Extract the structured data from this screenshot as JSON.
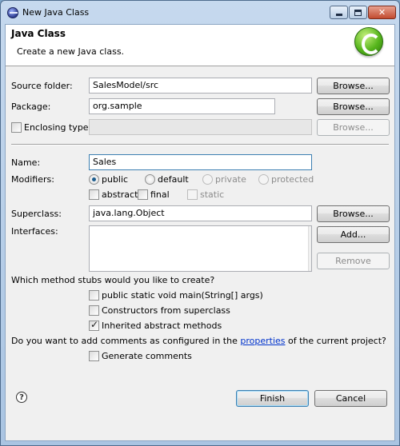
{
  "window": {
    "title": "New Java Class",
    "close_glyph": "✕",
    "buttons": [
      "minimize",
      "maximize",
      "close"
    ]
  },
  "banner": {
    "title": "Java Class",
    "description": "Create a new Java class.",
    "logo": "java-class-logo-icon"
  },
  "source_folder": {
    "label": "Source folder:",
    "value": "SalesModel/src",
    "browse": "Browse..."
  },
  "package": {
    "label": "Package:",
    "value": "org.sample",
    "browse": "Browse..."
  },
  "enclosing_type": {
    "label": "Enclosing type:",
    "value": "",
    "checked": false,
    "browse": "Browse..."
  },
  "name": {
    "label": "Name:",
    "value": "Sales"
  },
  "modifiers": {
    "label": "Modifiers:",
    "visibility": [
      {
        "label": "public",
        "selected": true,
        "enabled": true
      },
      {
        "label": "default",
        "selected": false,
        "enabled": true
      },
      {
        "label": "private",
        "selected": false,
        "enabled": false
      },
      {
        "label": "protected",
        "selected": false,
        "enabled": false
      }
    ],
    "flags": [
      {
        "label": "abstract",
        "checked": false,
        "enabled": true
      },
      {
        "label": "final",
        "checked": false,
        "enabled": true
      },
      {
        "label": "static",
        "checked": false,
        "enabled": false
      }
    ]
  },
  "superclass": {
    "label": "Superclass:",
    "value": "java.lang.Object",
    "browse": "Browse..."
  },
  "interfaces": {
    "label": "Interfaces:",
    "add": "Add...",
    "remove": "Remove"
  },
  "stubs": {
    "question": "Which method stubs would you like to create?",
    "options": [
      {
        "label": "public static void main(String[] args)",
        "checked": false
      },
      {
        "label": "Constructors from superclass",
        "checked": false
      },
      {
        "label": "Inherited abstract methods",
        "checked": true
      }
    ]
  },
  "comments": {
    "question_before": "Do you want to add comments as configured in the ",
    "question_link": "properties",
    "question_after": " of the current project?",
    "option": {
      "label": "Generate comments",
      "checked": false
    }
  },
  "footer": {
    "help": "?",
    "finish": "Finish",
    "cancel": "Cancel"
  },
  "colors": {
    "link": "#0033cc",
    "client_bg": "#f0f0f0",
    "close_button": "#c24b2f"
  }
}
